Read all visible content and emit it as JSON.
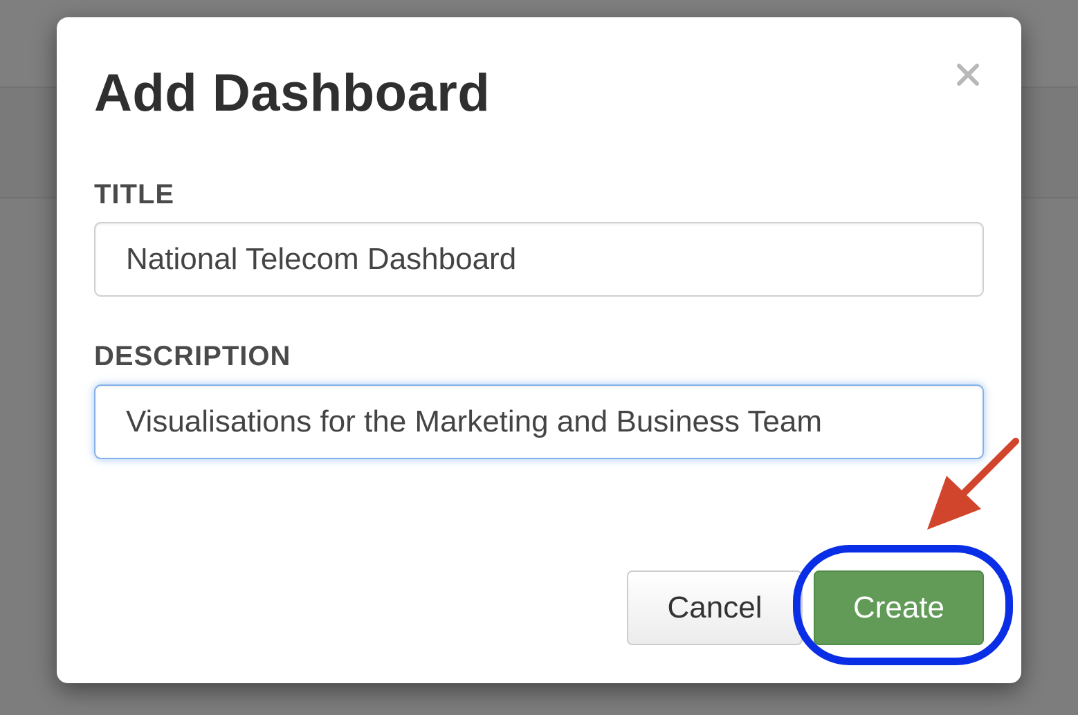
{
  "dialog": {
    "title": "Add Dashboard",
    "close_glyph": "×",
    "fields": {
      "title": {
        "label": "TITLE",
        "value": "National Telecom Dashboard"
      },
      "description": {
        "label": "DESCRIPTION",
        "value": "Visualisations for the Marketing and Business Team"
      }
    },
    "buttons": {
      "cancel": "Cancel",
      "create": "Create"
    }
  },
  "annotations": {
    "highlight_color": "#0a2ee6",
    "arrow_color": "#d2452d"
  },
  "colors": {
    "create_button": "#629b58",
    "focus_border": "#86b2ea"
  },
  "icons": {
    "close": "close-icon"
  }
}
